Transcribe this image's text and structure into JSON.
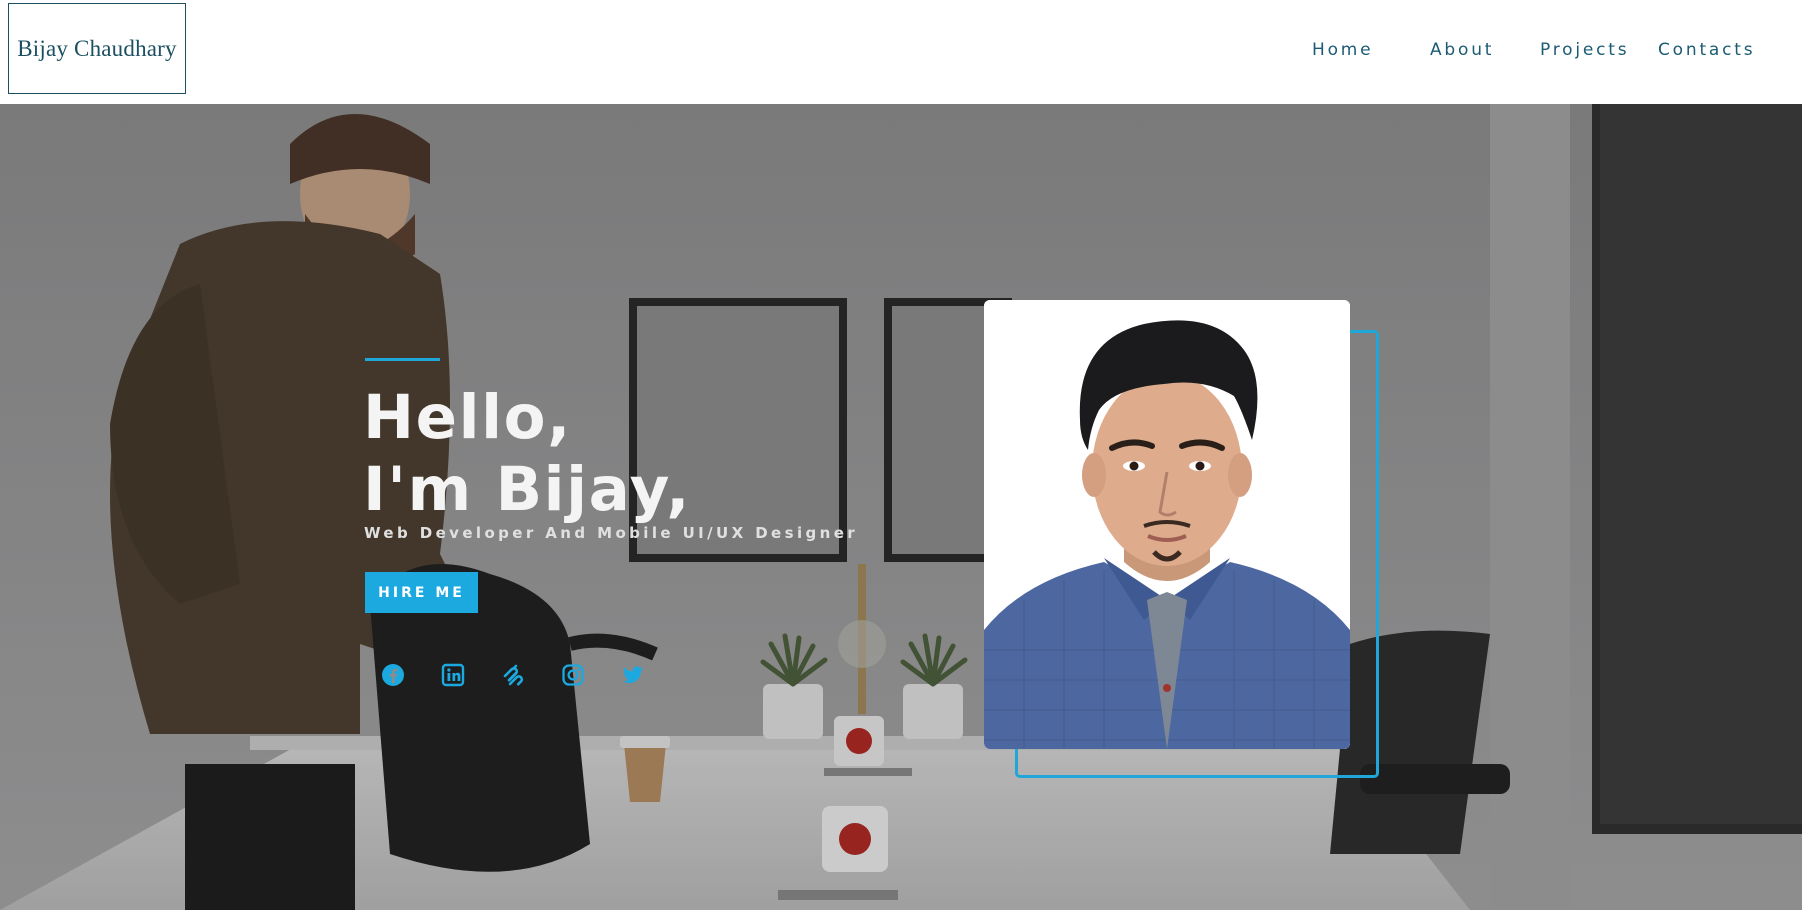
{
  "header": {
    "logo_text": "Bijay Chaudhary",
    "nav": [
      {
        "label": "Home"
      },
      {
        "label": "About"
      },
      {
        "label": "Projects"
      },
      {
        "label": "Contacts"
      }
    ]
  },
  "hero": {
    "greeting_line1": "Hello,",
    "greeting_line2": "I'm Bijay,",
    "subtitle": "Web Developer And Mobile UI/UX Designer",
    "hire_button": "HIRE ME",
    "socials": [
      {
        "icon": "facebook-icon"
      },
      {
        "icon": "linkedin-icon"
      },
      {
        "icon": "squarespace-icon"
      },
      {
        "icon": "instagram-icon"
      },
      {
        "icon": "twitter-icon"
      }
    ]
  },
  "colors": {
    "accent": "#1fa7d9",
    "nav_text": "#1b5b73",
    "logo": "#1b4f61"
  }
}
